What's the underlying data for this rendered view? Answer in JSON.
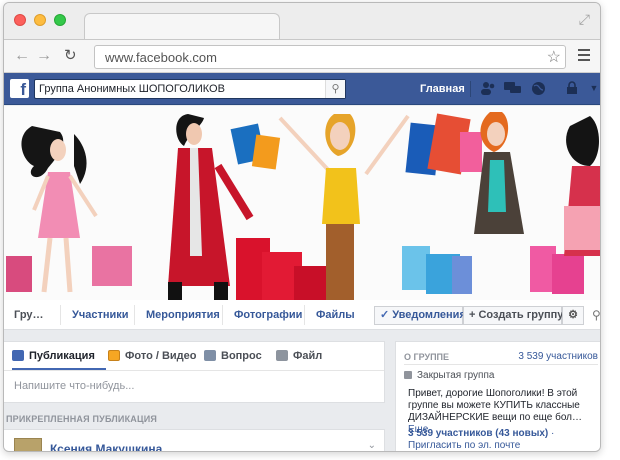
{
  "browser": {
    "url": "www.facebook.com"
  },
  "fb": {
    "search_value": "Группа Анонимных ШОПОГОЛИКОВ",
    "home_label": "Главная",
    "brand_color": "#3b5998"
  },
  "group_nav": {
    "tabs": [
      "Гру…",
      "Участники",
      "Мероприятия",
      "Фотографии",
      "Файлы"
    ],
    "notifications_label": "Уведомления",
    "create_group_label": "Создать группу"
  },
  "composer": {
    "tabs": [
      "Публикация",
      "Фото / Видео",
      "Вопрос",
      "Файл"
    ],
    "placeholder": "Напишите что-нибудь..."
  },
  "pinned": {
    "label": "ПРИКРЕПЛЕННАЯ ПУБЛИКАЦИЯ",
    "author": "Ксения Макушкина"
  },
  "about": {
    "heading": "О ГРУППЕ",
    "members_link": "3 539 участников",
    "privacy": "Закрытая группа",
    "description": "Привет, дорогие Шопоголики! В этой группе вы можете КУПИТЬ классные ДИЗАЙНЕРСКИЕ вещи по еще бол…",
    "more": "Еще",
    "stats": "3 539 участников (43 новых)",
    "invite": "· Пригласить по эл. почте"
  }
}
